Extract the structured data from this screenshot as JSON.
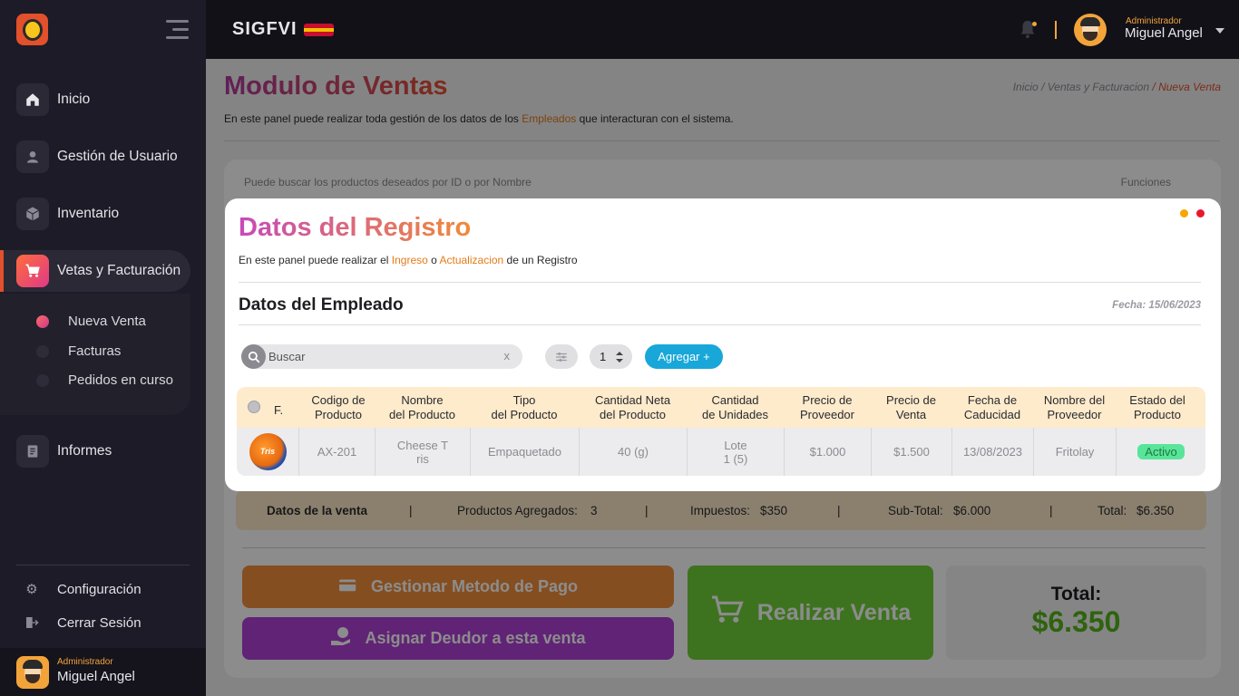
{
  "sidebar": {
    "nav": [
      {
        "label": "Inicio",
        "icon": "home-icon"
      },
      {
        "label": "Gestión de Usuario",
        "icon": "user-icon"
      },
      {
        "label": "Inventario",
        "icon": "box-icon"
      },
      {
        "label": "Vetas y Facturación",
        "icon": "cart-icon"
      }
    ],
    "sub_items": [
      "Nueva Venta",
      "Facturas",
      "Pedidos en curso"
    ],
    "informes": "Informes",
    "config": "Configuración",
    "logout": "Cerrar Sesión",
    "user": {
      "role": "Administrador",
      "name": "Miguel Angel"
    }
  },
  "topbar": {
    "brand": "SIGFVI",
    "user": {
      "role": "Administrador",
      "name": "Miguel Angel"
    }
  },
  "main": {
    "title": "Modulo de Ventas",
    "breadcrumb": {
      "home": "Inicio",
      "sep": "/",
      "section": "Ventas y Facturacion",
      "current": "Nueva Venta"
    },
    "desc_before": "En este panel puede realizar toda gestión de los datos de los ",
    "desc_link": "Empleados",
    "desc_after": " que interacturan con el sistema.",
    "search_hint": "Puede buscar los productos deseados por ID o por Nombre",
    "funciones": "Funciones",
    "totals": {
      "label": "Datos de la venta",
      "sep": "|",
      "products_label": "Productos Agregados:",
      "products_value": "3",
      "tax_label": "Impuestos:",
      "tax_value": "$350",
      "subtotal_label": "Sub-Total:",
      "subtotal_value": "$6.000",
      "total_label": "Total:",
      "total_value": "$6.350"
    },
    "pay_button": "Gestionar Metodo de Pago",
    "debtor_button": "Asignar Deudor a esta venta",
    "sale_button": "Realizar Venta",
    "total_box": {
      "label": "Total:",
      "value": "$6.350"
    }
  },
  "modal": {
    "title": "Datos del Registro",
    "desc_before": "En este panel puede realizar el ",
    "desc_link1": "Ingreso",
    "desc_mid": " o ",
    "desc_link2": "Actualizacion",
    "desc_after": " de un Registro",
    "subtitle": "Datos del Empleado",
    "date": "Fecha: 15/06/2023",
    "search_placeholder": "Buscar",
    "search_clear": "x",
    "qty_value": "1",
    "add_button": "Agregar +",
    "columns": [
      "F.",
      "Codigo de\nProducto",
      "Nombre\ndel Producto",
      "Tipo\ndel Producto",
      "Cantidad Neta\ndel Producto",
      "Cantidad\nde Unidades",
      "Precio de\nProveedor",
      "Precio de\nVenta",
      "Fecha de\nCaducidad",
      "Nombre del\nProveedor",
      "Estado del\nProducto"
    ],
    "row": {
      "image_label": "Tris",
      "code": "AX-201",
      "name": "Cheese T\nris",
      "type": "Empaquetado",
      "net": "40 (g)",
      "units": "Lote\n1 (5)",
      "cost": "$1.000",
      "price": "$1.500",
      "expiry": "13/08/2023",
      "supplier": "Fritolay",
      "status": "Activo"
    }
  },
  "colors": {
    "accent": "#e2502c",
    "sale_green": "#6fd13a",
    "pay_orange": "#f28f3b",
    "debtor_purple": "#b040d8",
    "add_blue": "#18a7d8",
    "status_green": "#58e59a"
  }
}
